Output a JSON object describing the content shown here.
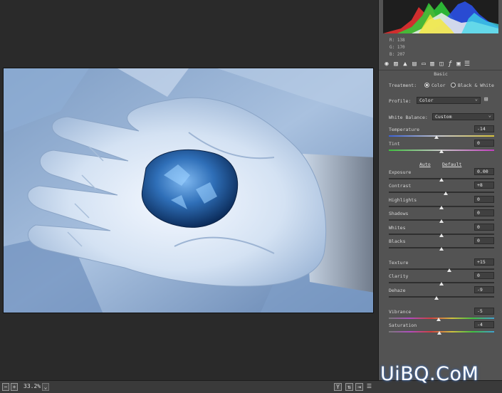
{
  "readout": {
    "r": "R:  138",
    "g": "G:  170",
    "b": "B:  207"
  },
  "section_title": "Basic",
  "treatment": {
    "label": "Treatment:",
    "option_color": "Color",
    "option_bw": "Black & White",
    "selected": "Color"
  },
  "profile": {
    "label": "Profile:",
    "value": "Color"
  },
  "white_balance": {
    "label": "White Balance:",
    "value": "Custom"
  },
  "links": {
    "auto": "Auto",
    "default": "Default"
  },
  "sliders": [
    {
      "label": "Temperature",
      "value": "-14",
      "level": 0.45,
      "track": "temp"
    },
    {
      "label": "Tint",
      "value": "0",
      "level": 0.5,
      "track": "tint"
    },
    {
      "label": "Exposure",
      "value": "0.00",
      "level": 0.5,
      "track": "plain"
    },
    {
      "label": "Contrast",
      "value": "+8",
      "level": 0.54,
      "track": "plain"
    },
    {
      "label": "Highlights",
      "value": "0",
      "level": 0.5,
      "track": "plain"
    },
    {
      "label": "Shadows",
      "value": "0",
      "level": 0.5,
      "track": "plain"
    },
    {
      "label": "Whites",
      "value": "0",
      "level": 0.5,
      "track": "plain"
    },
    {
      "label": "Blacks",
      "value": "0",
      "level": 0.5,
      "track": "plain"
    },
    {
      "label": "Texture",
      "value": "+15",
      "level": 0.575,
      "track": "plain"
    },
    {
      "label": "Clarity",
      "value": "0",
      "level": 0.5,
      "track": "plain"
    },
    {
      "label": "Dehaze",
      "value": "-9",
      "level": 0.455,
      "track": "plain"
    },
    {
      "label": "Vibrance",
      "value": "-5",
      "level": 0.475,
      "track": "vib"
    },
    {
      "label": "Saturation",
      "value": "-4",
      "level": 0.48,
      "track": "sat"
    }
  ],
  "statusbar": {
    "zoom": "33.2%",
    "y_label": "Y"
  },
  "watermark": "UiBQ.CoM",
  "icons": [
    "minus-square-icon",
    "plus-square-icon",
    "chevron-down-icon",
    "basic-tab-icon",
    "tone-curve-icon",
    "detail-icon",
    "hsl-icon",
    "split-tone-icon",
    "lens-icon",
    "fx-icon",
    "camera-calibration-icon",
    "presets-icon"
  ]
}
